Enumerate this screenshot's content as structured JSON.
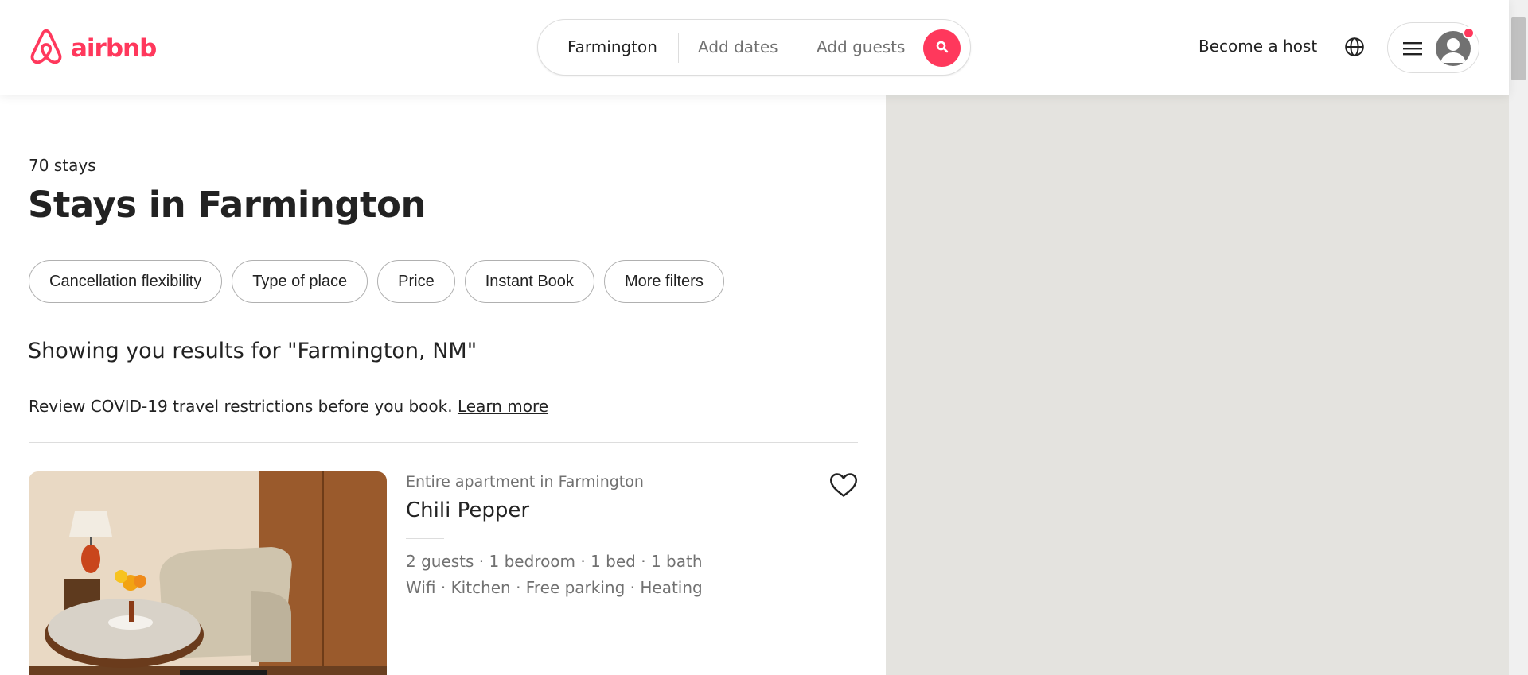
{
  "header": {
    "logo_text": "airbnb",
    "search": {
      "location": "Farmington",
      "dates": "Add dates",
      "guests": "Add guests"
    },
    "become_host": "Become a host"
  },
  "main": {
    "stays_count": "70 stays",
    "title": "Stays in Farmington",
    "filters": [
      "Cancellation flexibility",
      "Type of place",
      "Price",
      "Instant Book",
      "More filters"
    ],
    "results_for": "Showing you results for \"Farmington, NM\"",
    "covid_text": "Review COVID-19 travel restrictions before you book.",
    "covid_link": "Learn more"
  },
  "listing": {
    "type": "Entire apartment in Farmington",
    "title": "Chili Pepper",
    "details": "2 guests · 1 bedroom · 1 bed · 1 bath",
    "amenities": "Wifi · Kitchen · Free parking · Heating"
  },
  "colors": {
    "brand": "#FF385C",
    "text": "#222222",
    "muted": "#717171",
    "map": "#e4e3df"
  },
  "icons": [
    "airbnb-logo-icon",
    "search-icon",
    "globe-icon",
    "hamburger-menu-icon",
    "user-avatar-icon",
    "heart-icon"
  ]
}
